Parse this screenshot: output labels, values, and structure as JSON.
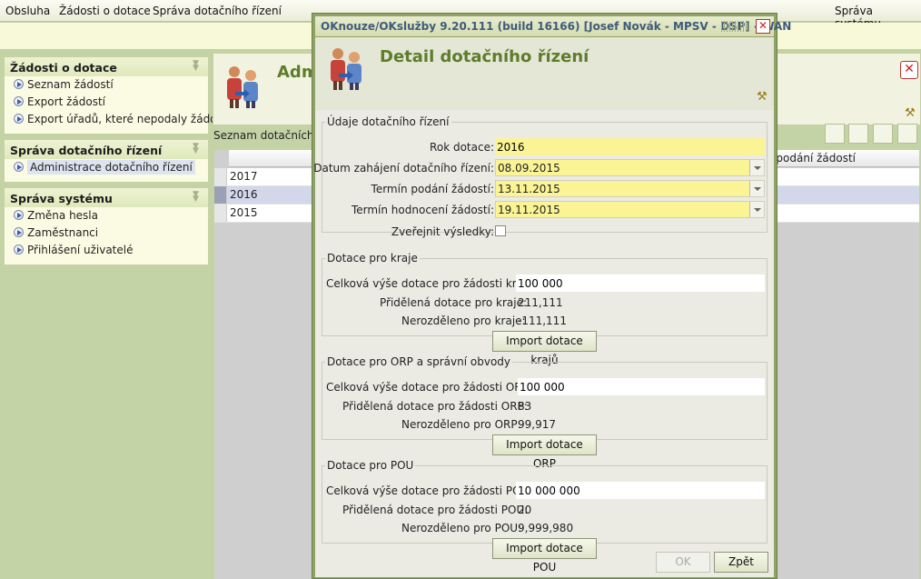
{
  "menu": {
    "items": [
      "Obsluha",
      "Žádosti o dotace",
      "Správa dotačního řízení"
    ],
    "right_item": "Správa systému"
  },
  "sidebar": {
    "sections": [
      {
        "title": "Žádosti o dotace",
        "items": [
          "Seznam žádostí",
          "Export žádostí",
          "Export úřadů, které nepodaly žádost"
        ]
      },
      {
        "title": "Správa dotačního řízení",
        "items": [
          "Administrace dotačního řízení"
        ]
      },
      {
        "title": "Správa systému",
        "items": [
          "Změna hesla",
          "Zaměstnanci",
          "Přihlášení uživatelé"
        ]
      }
    ]
  },
  "main": {
    "title": "Adm",
    "list_label": "Seznam dotačních ř",
    "column_right": "n podání žádostí",
    "rows": [
      "2017",
      "2016",
      "2015"
    ],
    "selected_row": 1
  },
  "dialog": {
    "window_title": "OKnouze/OKslužby 9.20.111 (build 16166)  [Josef Novák - MPSV - DSP] - WAN",
    "heading": "Detail dotačního řízení",
    "section_info": {
      "legend": "Údaje dotačního řízení",
      "rok_label": "Rok dotace:",
      "rok_value": "2016",
      "zahajeni_label": "Datum zahájení dotačního řízení:",
      "zahajeni_value": "08.09.2015",
      "podani_label": "Termín podání žádostí:",
      "podani_value": "13.11.2015",
      "hodnoceni_label": "Termín hodnocení žádostí:",
      "hodnoceni_value": "19.11.2015",
      "zverejnit_label": "Zveřejnit výsledky:",
      "zverejnit_checked": false
    },
    "section_kraje": {
      "legend": "Dotace pro kraje",
      "celkova_label": "Celková výše dotace pro žádosti krajů:",
      "celkova_value": "100 000",
      "pridelena_label": "Přidělená dotace pro kraje:",
      "pridelena_value": "211,111",
      "nerozdeleno_label": "Nerozděleno pro kraje:",
      "nerozdeleno_value": "-111,111",
      "import_label": "Import dotace krajů"
    },
    "section_orp": {
      "legend": "Dotace pro ORP a správní obvody",
      "celkova_label": "Celková výše dotace pro žádosti ORP:",
      "celkova_value": "100 000",
      "pridelena_label": "Přidělená dotace pro žádosti ORP:",
      "pridelena_value": "83",
      "nerozdeleno_label": "Nerozděleno pro ORP:",
      "nerozdeleno_value": "99,917",
      "import_label": "Import dotace ORP"
    },
    "section_pou": {
      "legend": "Dotace pro POU",
      "celkova_label": "Celková výše dotace pro žádosti POU:",
      "celkova_value": "10 000 000",
      "pridelena_label": "Přidělená dotace pro žádosti POU:",
      "pridelena_value": "20",
      "nerozdeleno_label": "Nerozděleno pro POU:",
      "nerozdeleno_value": "9,999,980",
      "import_label": "Import dotace POU"
    },
    "ok_label": "OK",
    "back_label": "Zpět"
  },
  "colors": {
    "accent_green": "#5d7d2a",
    "required_field": "#fbf495",
    "frame": "#8fa366"
  }
}
